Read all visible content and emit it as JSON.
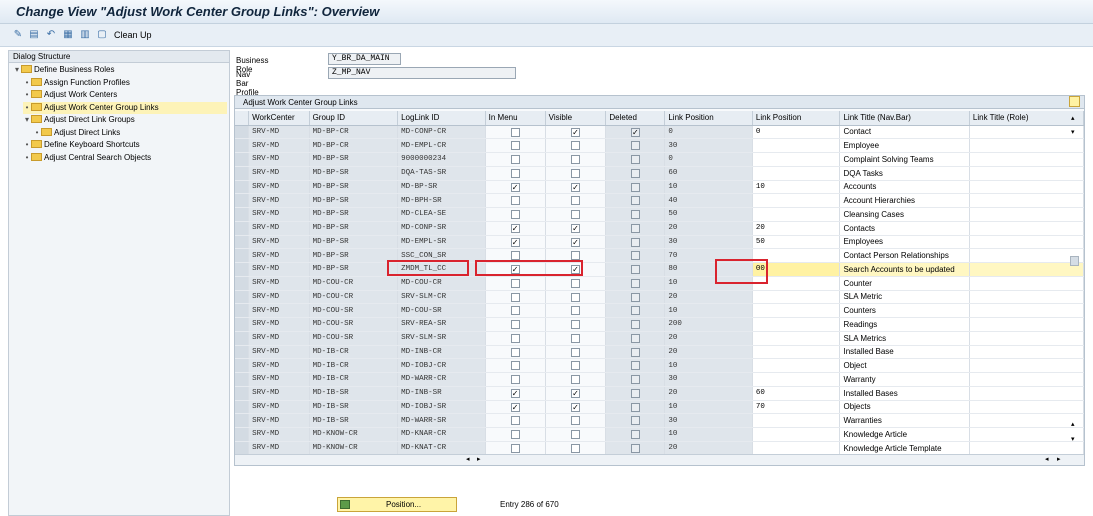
{
  "window": {
    "title": "Change View \"Adjust Work Center Group Links\": Overview"
  },
  "toolbar": {
    "clean_up_label": "Clean Up"
  },
  "dialog_structure": {
    "title": "Dialog Structure",
    "items": [
      {
        "label": "Define Business Roles",
        "level": 0,
        "selected": false
      },
      {
        "label": "Assign Function Profiles",
        "level": 1,
        "selected": false
      },
      {
        "label": "Adjust Work Centers",
        "level": 1,
        "selected": false
      },
      {
        "label": "Adjust Work Center Group Links",
        "level": 1,
        "selected": true
      },
      {
        "label": "Adjust Direct Link Groups",
        "level": 1,
        "selected": false
      },
      {
        "label": "Adjust Direct Links",
        "level": 2,
        "selected": false
      },
      {
        "label": "Define Keyboard Shortcuts",
        "level": 1,
        "selected": false
      },
      {
        "label": "Adjust Central Search Objects",
        "level": 1,
        "selected": false
      }
    ]
  },
  "fields": {
    "business_role_label": "Business Role",
    "business_role_value": "Y_BR_DA_MAIN",
    "nav_bar_profile_label": "Nav Bar Profile",
    "nav_bar_profile_value": "Z_MP_NAV"
  },
  "table": {
    "title": "Adjust Work Center Group Links",
    "columns": [
      "WorkCenter",
      "Group ID",
      "LogLink ID",
      "In Menu",
      "Visible",
      "Deleted",
      "Link Position",
      "Link Position",
      "Link Title (Nav.Bar)",
      "Link Title (Role)"
    ],
    "rows": [
      {
        "wc": "SRV-MD",
        "grp": "MD-BP-CR",
        "log": "MD-CONP-CR",
        "menu": false,
        "vis": true,
        "del": true,
        "pos1": "0",
        "pos2": "0",
        "title": "Contact"
      },
      {
        "wc": "SRV-MD",
        "grp": "MD-BP-CR",
        "log": "MD-EMPL-CR",
        "menu": false,
        "vis": false,
        "del": false,
        "pos1": "30",
        "pos2": "",
        "title": "Employee"
      },
      {
        "wc": "SRV-MD",
        "grp": "MD-BP-SR",
        "log": "9000000234",
        "menu": false,
        "vis": false,
        "del": false,
        "pos1": "0",
        "pos2": "",
        "title": "Complaint Solving Teams"
      },
      {
        "wc": "SRV-MD",
        "grp": "MD-BP-SR",
        "log": "DQA-TAS-SR",
        "menu": false,
        "vis": false,
        "del": false,
        "pos1": "60",
        "pos2": "",
        "title": "DQA Tasks"
      },
      {
        "wc": "SRV-MD",
        "grp": "MD-BP-SR",
        "log": "MD-BP-SR",
        "menu": true,
        "vis": true,
        "del": false,
        "pos1": "10",
        "pos2": "10",
        "title": "Accounts"
      },
      {
        "wc": "SRV-MD",
        "grp": "MD-BP-SR",
        "log": "MD-BPH-SR",
        "menu": false,
        "vis": false,
        "del": false,
        "pos1": "40",
        "pos2": "",
        "title": "Account Hierarchies"
      },
      {
        "wc": "SRV-MD",
        "grp": "MD-BP-SR",
        "log": "MD-CLEA-SE",
        "menu": false,
        "vis": false,
        "del": false,
        "pos1": "50",
        "pos2": "",
        "title": "Cleansing Cases"
      },
      {
        "wc": "SRV-MD",
        "grp": "MD-BP-SR",
        "log": "MD-CONP-SR",
        "menu": true,
        "vis": true,
        "del": false,
        "pos1": "20",
        "pos2": "20",
        "title": "Contacts"
      },
      {
        "wc": "SRV-MD",
        "grp": "MD-BP-SR",
        "log": "MD-EMPL-SR",
        "menu": true,
        "vis": true,
        "del": false,
        "pos1": "30",
        "pos2": "50",
        "title": "Employees"
      },
      {
        "wc": "SRV-MD",
        "grp": "MD-BP-SR",
        "log": "SSC_CON_SR",
        "menu": false,
        "vis": false,
        "del": false,
        "pos1": "70",
        "pos2": "",
        "title": "Contact Person Relationships"
      },
      {
        "wc": "SRV-MD",
        "grp": "MD-BP-SR",
        "log": "ZMDM_TL_CC",
        "menu": true,
        "vis": true,
        "del": false,
        "pos1": "80",
        "pos2": "00",
        "title": "Search Accounts to be updated",
        "highlight": true
      },
      {
        "wc": "SRV-MD",
        "grp": "MD-COU-CR",
        "log": "MD-COU-CR",
        "menu": false,
        "vis": false,
        "del": false,
        "pos1": "10",
        "pos2": "",
        "title": "Counter"
      },
      {
        "wc": "SRV-MD",
        "grp": "MD-COU-CR",
        "log": "SRV-SLM-CR",
        "menu": false,
        "vis": false,
        "del": false,
        "pos1": "20",
        "pos2": "",
        "title": "SLA Metric"
      },
      {
        "wc": "SRV-MD",
        "grp": "MD-COU-SR",
        "log": "MD-COU-SR",
        "menu": false,
        "vis": false,
        "del": false,
        "pos1": "10",
        "pos2": "",
        "title": "Counters"
      },
      {
        "wc": "SRV-MD",
        "grp": "MD-COU-SR",
        "log": "SRV-REA-SR",
        "menu": false,
        "vis": false,
        "del": false,
        "pos1": "200",
        "pos2": "",
        "title": "Readings"
      },
      {
        "wc": "SRV-MD",
        "grp": "MD-COU-SR",
        "log": "SRV-SLM-SR",
        "menu": false,
        "vis": false,
        "del": false,
        "pos1": "20",
        "pos2": "",
        "title": "SLA Metrics"
      },
      {
        "wc": "SRV-MD",
        "grp": "MD-IB-CR",
        "log": "MD-INB-CR",
        "menu": false,
        "vis": false,
        "del": false,
        "pos1": "20",
        "pos2": "",
        "title": "Installed Base"
      },
      {
        "wc": "SRV-MD",
        "grp": "MD-IB-CR",
        "log": "MD-IOBJ-CR",
        "menu": false,
        "vis": false,
        "del": false,
        "pos1": "10",
        "pos2": "",
        "title": "Object"
      },
      {
        "wc": "SRV-MD",
        "grp": "MD-IB-CR",
        "log": "MD-WARR-CR",
        "menu": false,
        "vis": false,
        "del": false,
        "pos1": "30",
        "pos2": "",
        "title": "Warranty"
      },
      {
        "wc": "SRV-MD",
        "grp": "MD-IB-SR",
        "log": "MD-INB-SR",
        "menu": true,
        "vis": true,
        "del": false,
        "pos1": "20",
        "pos2": "60",
        "title": "Installed Bases"
      },
      {
        "wc": "SRV-MD",
        "grp": "MD-IB-SR",
        "log": "MD-IOBJ-SR",
        "menu": true,
        "vis": true,
        "del": false,
        "pos1": "10",
        "pos2": "70",
        "title": "Objects"
      },
      {
        "wc": "SRV-MD",
        "grp": "MD-IB-SR",
        "log": "MD-WARR-SR",
        "menu": false,
        "vis": false,
        "del": false,
        "pos1": "30",
        "pos2": "",
        "title": "Warranties"
      },
      {
        "wc": "SRV-MD",
        "grp": "MD-KNOW-CR",
        "log": "MD-KNAR-CR",
        "menu": false,
        "vis": false,
        "del": false,
        "pos1": "10",
        "pos2": "",
        "title": "Knowledge Article"
      },
      {
        "wc": "SRV-MD",
        "grp": "MD-KNOW-CR",
        "log": "MD-KNAT-CR",
        "menu": false,
        "vis": false,
        "del": false,
        "pos1": "20",
        "pos2": "",
        "title": "Knowledge Article Template"
      }
    ]
  },
  "footer": {
    "position_button_label": "Position...",
    "entry_text": "Entry 286 of 670"
  },
  "colors": {
    "highlight_red": "#d9232e",
    "selected_tree": "#fdf3b8",
    "button_yellow": "#fff4a8"
  }
}
